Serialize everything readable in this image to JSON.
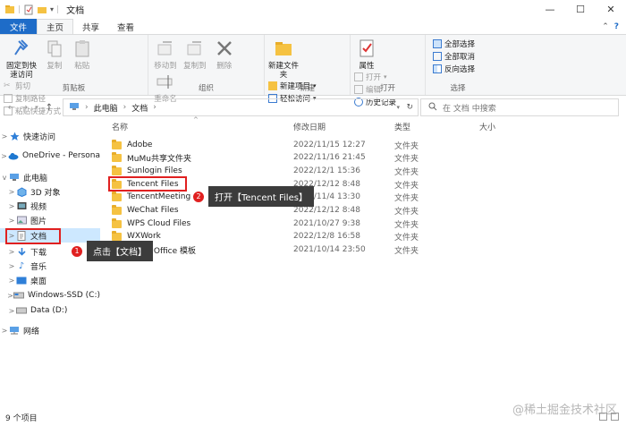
{
  "window": {
    "title": "文档"
  },
  "tabs": [
    "文件",
    "主页",
    "共享",
    "查看"
  ],
  "ribbon": {
    "clipboard": {
      "label": "剪贴板",
      "pin": "固定到快速访问",
      "copy": "复制",
      "paste": "粘贴",
      "cut": "剪切",
      "copy_path": "复制路径",
      "paste_shortcut": "粘贴快捷方式"
    },
    "organize": {
      "label": "组织",
      "move_to": "移动到",
      "copy_to": "复制到",
      "delete": "删除",
      "rename": "重命名"
    },
    "new": {
      "label": "新建",
      "new_folder": "新建文件夹",
      "new_item": "新建项目",
      "easy_access": "轻松访问"
    },
    "open": {
      "label": "打开",
      "properties": "属性",
      "open": "打开",
      "edit": "编辑",
      "history": "历史记录"
    },
    "select": {
      "label": "选择",
      "select_all": "全部选择",
      "select_none": "全部取消",
      "invert": "反向选择"
    }
  },
  "address": {
    "crumbs": [
      "此电脑",
      "文档"
    ],
    "search_placeholder": "在 文档 中搜索"
  },
  "nav": [
    {
      "label": "快速访问",
      "chev": ">",
      "icon": "star"
    },
    {
      "label": "OneDrive - Persona",
      "chev": ">",
      "icon": "cloud"
    },
    {
      "label": "此电脑",
      "chev": "v",
      "icon": "pc"
    },
    {
      "label": "3D 对象",
      "chev": ">",
      "icon": "cube"
    },
    {
      "label": "视频",
      "chev": ">",
      "icon": "video"
    },
    {
      "label": "图片",
      "chev": ">",
      "icon": "picture"
    },
    {
      "label": "文档",
      "chev": ">",
      "icon": "doc"
    },
    {
      "label": "下载",
      "chev": ">",
      "icon": "download"
    },
    {
      "label": "音乐",
      "chev": ">",
      "icon": "music"
    },
    {
      "label": "桌面",
      "chev": ">",
      "icon": "desktop"
    },
    {
      "label": "Windows-SSD (C:)",
      "chev": ">",
      "icon": "drive"
    },
    {
      "label": "Data (D:)",
      "chev": ">",
      "icon": "drive"
    },
    {
      "label": "网络",
      "chev": ">",
      "icon": "network"
    }
  ],
  "columns": {
    "name": "名称",
    "date": "修改日期",
    "type": "类型",
    "size": "大小"
  },
  "files": [
    {
      "name": "Adobe",
      "date": "2022/11/15 12:27",
      "type": "文件夹"
    },
    {
      "name": "MuMu共享文件夹",
      "date": "2022/11/16 21:45",
      "type": "文件夹"
    },
    {
      "name": "Sunlogin Files",
      "date": "2022/12/1 15:36",
      "type": "文件夹"
    },
    {
      "name": "Tencent Files",
      "date": "2022/12/12 8:48",
      "type": "文件夹"
    },
    {
      "name": "TencentMeeting",
      "date": "2022/11/4 13:30",
      "type": "文件夹"
    },
    {
      "name": "WeChat Files",
      "date": "2022/12/12 8:48",
      "type": "文件夹"
    },
    {
      "name": "WPS Cloud Files",
      "date": "2021/10/27 9:38",
      "type": "文件夹"
    },
    {
      "name": "WXWork",
      "date": "2022/12/8 16:58",
      "type": "文件夹"
    },
    {
      "name": "自定义 Office 模板",
      "date": "2021/10/14 23:50",
      "type": "文件夹"
    }
  ],
  "annotations": {
    "step1": {
      "num": "1",
      "text": "点击【文档】"
    },
    "step2": {
      "num": "2",
      "text": "打开【Tencent Files】"
    }
  },
  "status": {
    "count": "9 个项目"
  },
  "watermark": "@稀土掘金技术社区",
  "colors": {
    "accent": "#1e6cc8",
    "folder": "#f5c242",
    "highlight": "#e02020",
    "selected": "#cde8ff"
  }
}
